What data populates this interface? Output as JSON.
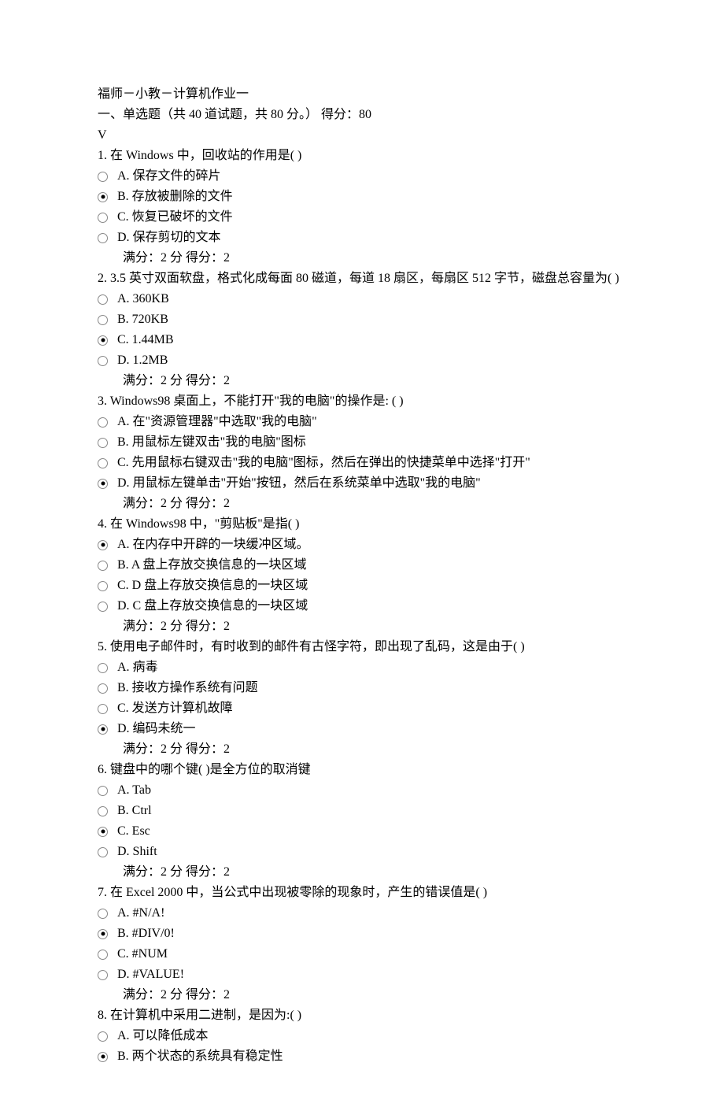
{
  "header": {
    "title": "福师－小教－计算机作业一",
    "section": "一、单选题（共 40 道试题，共 80 分。）    得分：80",
    "marker": "V"
  },
  "questions": [
    {
      "num": "1.",
      "stem": " 在 Windows 中，回收站的作用是( )",
      "options": [
        {
          "letter": "A.",
          "text": " 保存文件的碎片",
          "selected": false
        },
        {
          "letter": "B.",
          "text": " 存放被删除的文件",
          "selected": true
        },
        {
          "letter": "C.",
          "text": " 恢复已破坏的文件",
          "selected": false
        },
        {
          "letter": "D.",
          "text": " 保存剪切的文本",
          "selected": false
        }
      ],
      "score": "满分：2  分  得分：2"
    },
    {
      "num": "2.",
      "stem": " 3.5 英寸双面软盘，格式化成每面 80 磁道，每道 18 扇区，每扇区 512 字节，磁盘总容量为( )",
      "options": [
        {
          "letter": "A.",
          "text": " 360KB",
          "selected": false
        },
        {
          "letter": "B.",
          "text": " 720KB",
          "selected": false
        },
        {
          "letter": "C.",
          "text": " 1.44MB",
          "selected": true
        },
        {
          "letter": "D.",
          "text": " 1.2MB",
          "selected": false
        }
      ],
      "score": "满分：2  分  得分：2"
    },
    {
      "num": "3.",
      "stem": " Windows98 桌面上，不能打开\"我的电脑\"的操作是:  ( )",
      "options": [
        {
          "letter": "A.",
          "text": " 在\"资源管理器\"中选取\"我的电脑\"",
          "selected": false
        },
        {
          "letter": "B.",
          "text": " 用鼠标左键双击\"我的电脑\"图标",
          "selected": false
        },
        {
          "letter": "C.",
          "text": " 先用鼠标右键双击\"我的电脑\"图标，然后在弹出的快捷菜单中选择\"打开\"",
          "selected": false
        },
        {
          "letter": "D.",
          "text": " 用鼠标左键单击\"开始\"按钮，然后在系统菜单中选取\"我的电脑\"",
          "selected": true
        }
      ],
      "score": "满分：2  分  得分：2"
    },
    {
      "num": "4.",
      "stem": " 在 Windows98 中，\"剪贴板\"是指( )",
      "options": [
        {
          "letter": "A.",
          "text": " 在内存中开辟的一块缓冲区域。",
          "selected": true
        },
        {
          "letter": "B.",
          "text": " A 盘上存放交换信息的一块区域",
          "selected": false
        },
        {
          "letter": "C.",
          "text": " D 盘上存放交换信息的一块区域",
          "selected": false
        },
        {
          "letter": "D.",
          "text": " C 盘上存放交换信息的一块区域",
          "selected": false
        }
      ],
      "score": "满分：2  分  得分：2"
    },
    {
      "num": "5.",
      "stem": " 使用电子邮件时，有时收到的邮件有古怪字符，即出现了乱码，这是由于( )",
      "options": [
        {
          "letter": "A.",
          "text": " 病毒",
          "selected": false
        },
        {
          "letter": "B.",
          "text": " 接收方操作系统有问题",
          "selected": false
        },
        {
          "letter": "C.",
          "text": " 发送方计算机故障",
          "selected": false
        },
        {
          "letter": "D.",
          "text": " 编码未统一",
          "selected": true
        }
      ],
      "score": "满分：2  分  得分：2"
    },
    {
      "num": "6.",
      "stem": " 键盘中的哪个键( )是全方位的取消键",
      "options": [
        {
          "letter": "A.",
          "text": " Tab",
          "selected": false
        },
        {
          "letter": "B.",
          "text": " Ctrl",
          "selected": false
        },
        {
          "letter": "C.",
          "text": " Esc",
          "selected": true
        },
        {
          "letter": "D.",
          "text": " Shift",
          "selected": false
        }
      ],
      "score": "满分：2  分  得分：2"
    },
    {
      "num": "7.",
      "stem": " 在 Excel 2000 中，当公式中出现被零除的现象时，产生的错误值是( )",
      "options": [
        {
          "letter": "A.",
          "text": " #N/A!",
          "selected": false
        },
        {
          "letter": "B.",
          "text": " #DIV/0!",
          "selected": true
        },
        {
          "letter": "C.",
          "text": " #NUM",
          "selected": false
        },
        {
          "letter": "D.",
          "text": " #VALUE!",
          "selected": false
        }
      ],
      "score": "满分：2  分  得分：2"
    },
    {
      "num": "8.",
      "stem": " 在计算机中采用二进制，是因为:( )",
      "options": [
        {
          "letter": "A.",
          "text": " 可以降低成本",
          "selected": false
        },
        {
          "letter": "B.",
          "text": " 两个状态的系统具有稳定性",
          "selected": true
        }
      ],
      "score": ""
    }
  ]
}
